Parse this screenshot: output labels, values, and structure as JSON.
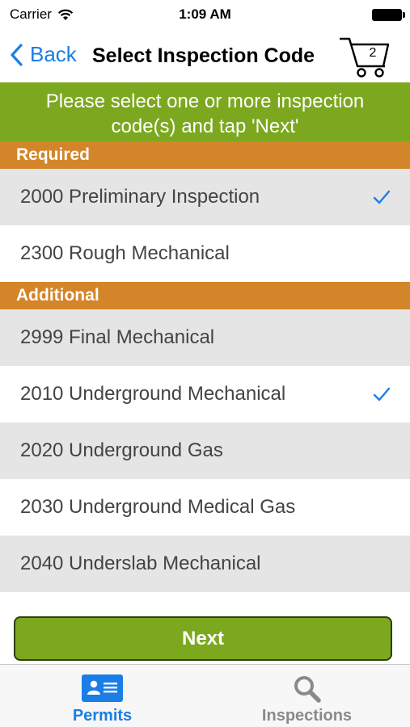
{
  "status_bar": {
    "carrier": "Carrier",
    "time": "1:09 AM"
  },
  "nav": {
    "back_label": "Back",
    "title": "Select Inspection Code",
    "cart_count": "2"
  },
  "instruction": "Please select one or more inspection code(s) and tap 'Next'",
  "sections": {
    "required": {
      "label": "Required",
      "items": [
        {
          "label": "2000 Preliminary Inspection",
          "selected": true
        },
        {
          "label": "2300 Rough Mechanical",
          "selected": false
        }
      ]
    },
    "additional": {
      "label": "Additional",
      "items": [
        {
          "label": "2999 Final Mechanical",
          "selected": false
        },
        {
          "label": "2010 Underground Mechanical",
          "selected": true
        },
        {
          "label": "2020 Underground Gas",
          "selected": false
        },
        {
          "label": "2030 Underground Medical Gas",
          "selected": false
        },
        {
          "label": "2040 Underslab Mechanical",
          "selected": false
        }
      ]
    }
  },
  "next_label": "Next",
  "tabs": [
    {
      "label": "Permits",
      "icon": "permits-icon",
      "active": true
    },
    {
      "label": "Inspections",
      "icon": "search-icon",
      "active": false
    }
  ],
  "colors": {
    "accent_blue": "#1a7ee6",
    "banner_green": "#7ca81f",
    "section_orange": "#d4852a"
  }
}
